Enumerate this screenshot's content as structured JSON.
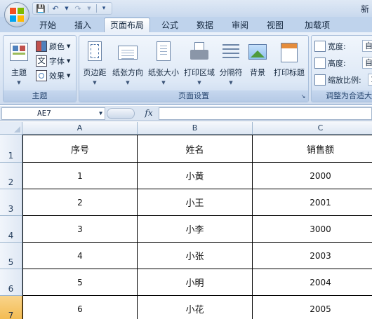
{
  "titlebar": {
    "title_fragment": "新"
  },
  "tabs": [
    "开始",
    "插入",
    "页面布局",
    "公式",
    "数据",
    "审阅",
    "视图",
    "加载项"
  ],
  "ribbon": {
    "theme_group": {
      "big": {
        "label": "主题"
      },
      "colors": "颜色",
      "fonts": "字体",
      "effects": "效果",
      "label": "主题"
    },
    "page_setup_group": {
      "buttons": [
        "页边距",
        "纸张方向",
        "纸张大小",
        "打印区域",
        "分隔符",
        "背景",
        "打印标题"
      ],
      "label": "页面设置"
    },
    "scale_group": {
      "width_label": "宽度:",
      "width_value": "自",
      "height_label": "高度:",
      "height_value": "自",
      "scale_label": "缩放比例:",
      "scale_value": "1",
      "label": "调整为合适大"
    }
  },
  "formula_bar": {
    "name_box": "AE7",
    "fx": "fx",
    "formula": ""
  },
  "sheet": {
    "columns": [
      "A",
      "B",
      "C"
    ],
    "rows": [
      "1",
      "2",
      "3",
      "4",
      "5",
      "6",
      "7"
    ],
    "selected_row": "7",
    "header": [
      "序号",
      "姓名",
      "销售额"
    ],
    "data": [
      [
        "1",
        "小黄",
        "2000"
      ],
      [
        "2",
        "小王",
        "2001"
      ],
      [
        "3",
        "小李",
        "3000"
      ],
      [
        "4",
        "小张",
        "2003"
      ],
      [
        "5",
        "小明",
        "2004"
      ],
      [
        "6",
        "小花",
        "2005"
      ]
    ]
  }
}
